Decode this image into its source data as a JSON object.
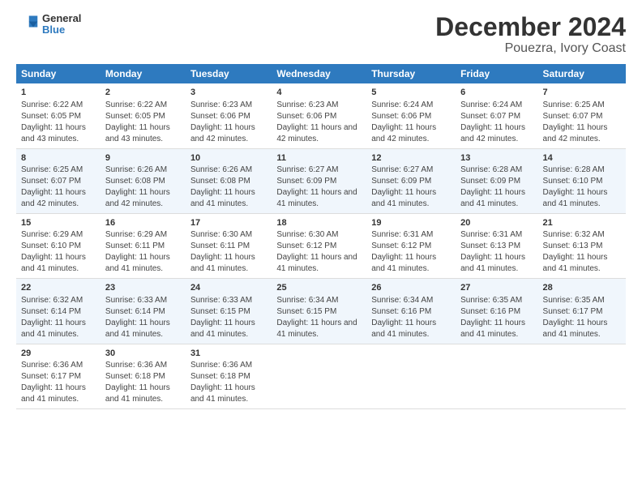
{
  "logo": {
    "line1": "General",
    "line2": "Blue"
  },
  "title": "December 2024",
  "subtitle": "Pouezra, Ivory Coast",
  "headers": [
    "Sunday",
    "Monday",
    "Tuesday",
    "Wednesday",
    "Thursday",
    "Friday",
    "Saturday"
  ],
  "weeks": [
    [
      {
        "day": "1",
        "rise": "Sunrise: 6:22 AM",
        "set": "Sunset: 6:05 PM",
        "daylight": "Daylight: 11 hours and 43 minutes."
      },
      {
        "day": "2",
        "rise": "Sunrise: 6:22 AM",
        "set": "Sunset: 6:05 PM",
        "daylight": "Daylight: 11 hours and 43 minutes."
      },
      {
        "day": "3",
        "rise": "Sunrise: 6:23 AM",
        "set": "Sunset: 6:06 PM",
        "daylight": "Daylight: 11 hours and 42 minutes."
      },
      {
        "day": "4",
        "rise": "Sunrise: 6:23 AM",
        "set": "Sunset: 6:06 PM",
        "daylight": "Daylight: 11 hours and 42 minutes."
      },
      {
        "day": "5",
        "rise": "Sunrise: 6:24 AM",
        "set": "Sunset: 6:06 PM",
        "daylight": "Daylight: 11 hours and 42 minutes."
      },
      {
        "day": "6",
        "rise": "Sunrise: 6:24 AM",
        "set": "Sunset: 6:07 PM",
        "daylight": "Daylight: 11 hours and 42 minutes."
      },
      {
        "day": "7",
        "rise": "Sunrise: 6:25 AM",
        "set": "Sunset: 6:07 PM",
        "daylight": "Daylight: 11 hours and 42 minutes."
      }
    ],
    [
      {
        "day": "8",
        "rise": "Sunrise: 6:25 AM",
        "set": "Sunset: 6:07 PM",
        "daylight": "Daylight: 11 hours and 42 minutes."
      },
      {
        "day": "9",
        "rise": "Sunrise: 6:26 AM",
        "set": "Sunset: 6:08 PM",
        "daylight": "Daylight: 11 hours and 42 minutes."
      },
      {
        "day": "10",
        "rise": "Sunrise: 6:26 AM",
        "set": "Sunset: 6:08 PM",
        "daylight": "Daylight: 11 hours and 41 minutes."
      },
      {
        "day": "11",
        "rise": "Sunrise: 6:27 AM",
        "set": "Sunset: 6:09 PM",
        "daylight": "Daylight: 11 hours and 41 minutes."
      },
      {
        "day": "12",
        "rise": "Sunrise: 6:27 AM",
        "set": "Sunset: 6:09 PM",
        "daylight": "Daylight: 11 hours and 41 minutes."
      },
      {
        "day": "13",
        "rise": "Sunrise: 6:28 AM",
        "set": "Sunset: 6:09 PM",
        "daylight": "Daylight: 11 hours and 41 minutes."
      },
      {
        "day": "14",
        "rise": "Sunrise: 6:28 AM",
        "set": "Sunset: 6:10 PM",
        "daylight": "Daylight: 11 hours and 41 minutes."
      }
    ],
    [
      {
        "day": "15",
        "rise": "Sunrise: 6:29 AM",
        "set": "Sunset: 6:10 PM",
        "daylight": "Daylight: 11 hours and 41 minutes."
      },
      {
        "day": "16",
        "rise": "Sunrise: 6:29 AM",
        "set": "Sunset: 6:11 PM",
        "daylight": "Daylight: 11 hours and 41 minutes."
      },
      {
        "day": "17",
        "rise": "Sunrise: 6:30 AM",
        "set": "Sunset: 6:11 PM",
        "daylight": "Daylight: 11 hours and 41 minutes."
      },
      {
        "day": "18",
        "rise": "Sunrise: 6:30 AM",
        "set": "Sunset: 6:12 PM",
        "daylight": "Daylight: 11 hours and 41 minutes."
      },
      {
        "day": "19",
        "rise": "Sunrise: 6:31 AM",
        "set": "Sunset: 6:12 PM",
        "daylight": "Daylight: 11 hours and 41 minutes."
      },
      {
        "day": "20",
        "rise": "Sunrise: 6:31 AM",
        "set": "Sunset: 6:13 PM",
        "daylight": "Daylight: 11 hours and 41 minutes."
      },
      {
        "day": "21",
        "rise": "Sunrise: 6:32 AM",
        "set": "Sunset: 6:13 PM",
        "daylight": "Daylight: 11 hours and 41 minutes."
      }
    ],
    [
      {
        "day": "22",
        "rise": "Sunrise: 6:32 AM",
        "set": "Sunset: 6:14 PM",
        "daylight": "Daylight: 11 hours and 41 minutes."
      },
      {
        "day": "23",
        "rise": "Sunrise: 6:33 AM",
        "set": "Sunset: 6:14 PM",
        "daylight": "Daylight: 11 hours and 41 minutes."
      },
      {
        "day": "24",
        "rise": "Sunrise: 6:33 AM",
        "set": "Sunset: 6:15 PM",
        "daylight": "Daylight: 11 hours and 41 minutes."
      },
      {
        "day": "25",
        "rise": "Sunrise: 6:34 AM",
        "set": "Sunset: 6:15 PM",
        "daylight": "Daylight: 11 hours and 41 minutes."
      },
      {
        "day": "26",
        "rise": "Sunrise: 6:34 AM",
        "set": "Sunset: 6:16 PM",
        "daylight": "Daylight: 11 hours and 41 minutes."
      },
      {
        "day": "27",
        "rise": "Sunrise: 6:35 AM",
        "set": "Sunset: 6:16 PM",
        "daylight": "Daylight: 11 hours and 41 minutes."
      },
      {
        "day": "28",
        "rise": "Sunrise: 6:35 AM",
        "set": "Sunset: 6:17 PM",
        "daylight": "Daylight: 11 hours and 41 minutes."
      }
    ],
    [
      {
        "day": "29",
        "rise": "Sunrise: 6:36 AM",
        "set": "Sunset: 6:17 PM",
        "daylight": "Daylight: 11 hours and 41 minutes."
      },
      {
        "day": "30",
        "rise": "Sunrise: 6:36 AM",
        "set": "Sunset: 6:18 PM",
        "daylight": "Daylight: 11 hours and 41 minutes."
      },
      {
        "day": "31",
        "rise": "Sunrise: 6:36 AM",
        "set": "Sunset: 6:18 PM",
        "daylight": "Daylight: 11 hours and 41 minutes."
      },
      null,
      null,
      null,
      null
    ]
  ]
}
